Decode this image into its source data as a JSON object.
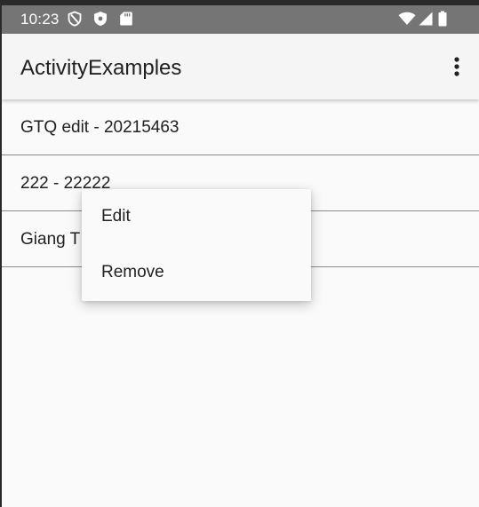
{
  "status_bar": {
    "time": "10:23",
    "left_icons": [
      "data-saver-icon",
      "shield-icon",
      "sd-card-icon"
    ],
    "right_icons": [
      "wifi-icon",
      "signal-icon",
      "battery-icon"
    ]
  },
  "app_bar": {
    "title": "ActivityExamples",
    "overflow_icon": "more-vert-icon"
  },
  "list": {
    "items": [
      {
        "label": "GTQ edit - 20215463"
      },
      {
        "label": "222 - 22222"
      },
      {
        "label": "Giang T"
      }
    ]
  },
  "context_menu": {
    "items": [
      {
        "label": "Edit"
      },
      {
        "label": "Remove"
      }
    ]
  },
  "colors": {
    "status_bar": "#757575",
    "app_bar": "#f5f5f5",
    "background": "#fafafa",
    "text": "#212121",
    "divider": "#8a8a8a"
  }
}
